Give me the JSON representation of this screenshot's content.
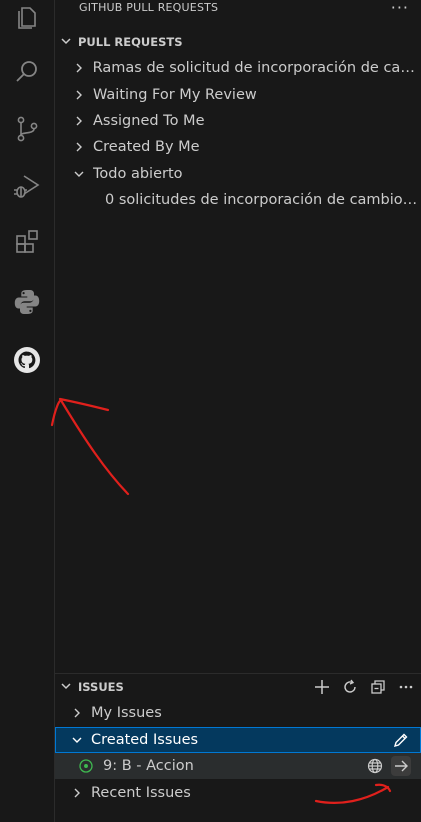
{
  "sidebar": {
    "title": "GITHUB PULL REQUESTS",
    "more_label": "···"
  },
  "pull_requests": {
    "header": "PULL REQUESTS",
    "items": [
      {
        "label": "Ramas de solicitud de incorporación de cam...",
        "expanded": false
      },
      {
        "label": "Waiting For My Review",
        "expanded": false
      },
      {
        "label": "Assigned To Me",
        "expanded": false
      },
      {
        "label": "Created By Me",
        "expanded": false
      },
      {
        "label": "Todo abierto",
        "expanded": true
      }
    ],
    "child_text": "0 solicitudes de incorporación de cambios ..."
  },
  "issues": {
    "header": "ISSUES",
    "items": [
      {
        "label": "My Issues",
        "expanded": false
      },
      {
        "label": "Created Issues",
        "expanded": true
      },
      {
        "label": "Recent Issues",
        "expanded": false
      }
    ],
    "created_issue": {
      "label": "9: B - Accion"
    }
  },
  "colors": {
    "accent": "#0078d4",
    "selection": "#04395e",
    "issue_open": "#3fb950",
    "annotation": "#e0201c"
  },
  "icons": [
    "explorer-icon",
    "search-icon",
    "source-control-icon",
    "run-debug-icon",
    "extensions-icon",
    "python-icon",
    "github-icon",
    "chevron-right-icon",
    "chevron-down-icon",
    "plus-icon",
    "refresh-icon",
    "collapse-all-icon",
    "edit-icon",
    "globe-icon",
    "arrow-right-icon",
    "issue-opened-icon"
  ]
}
